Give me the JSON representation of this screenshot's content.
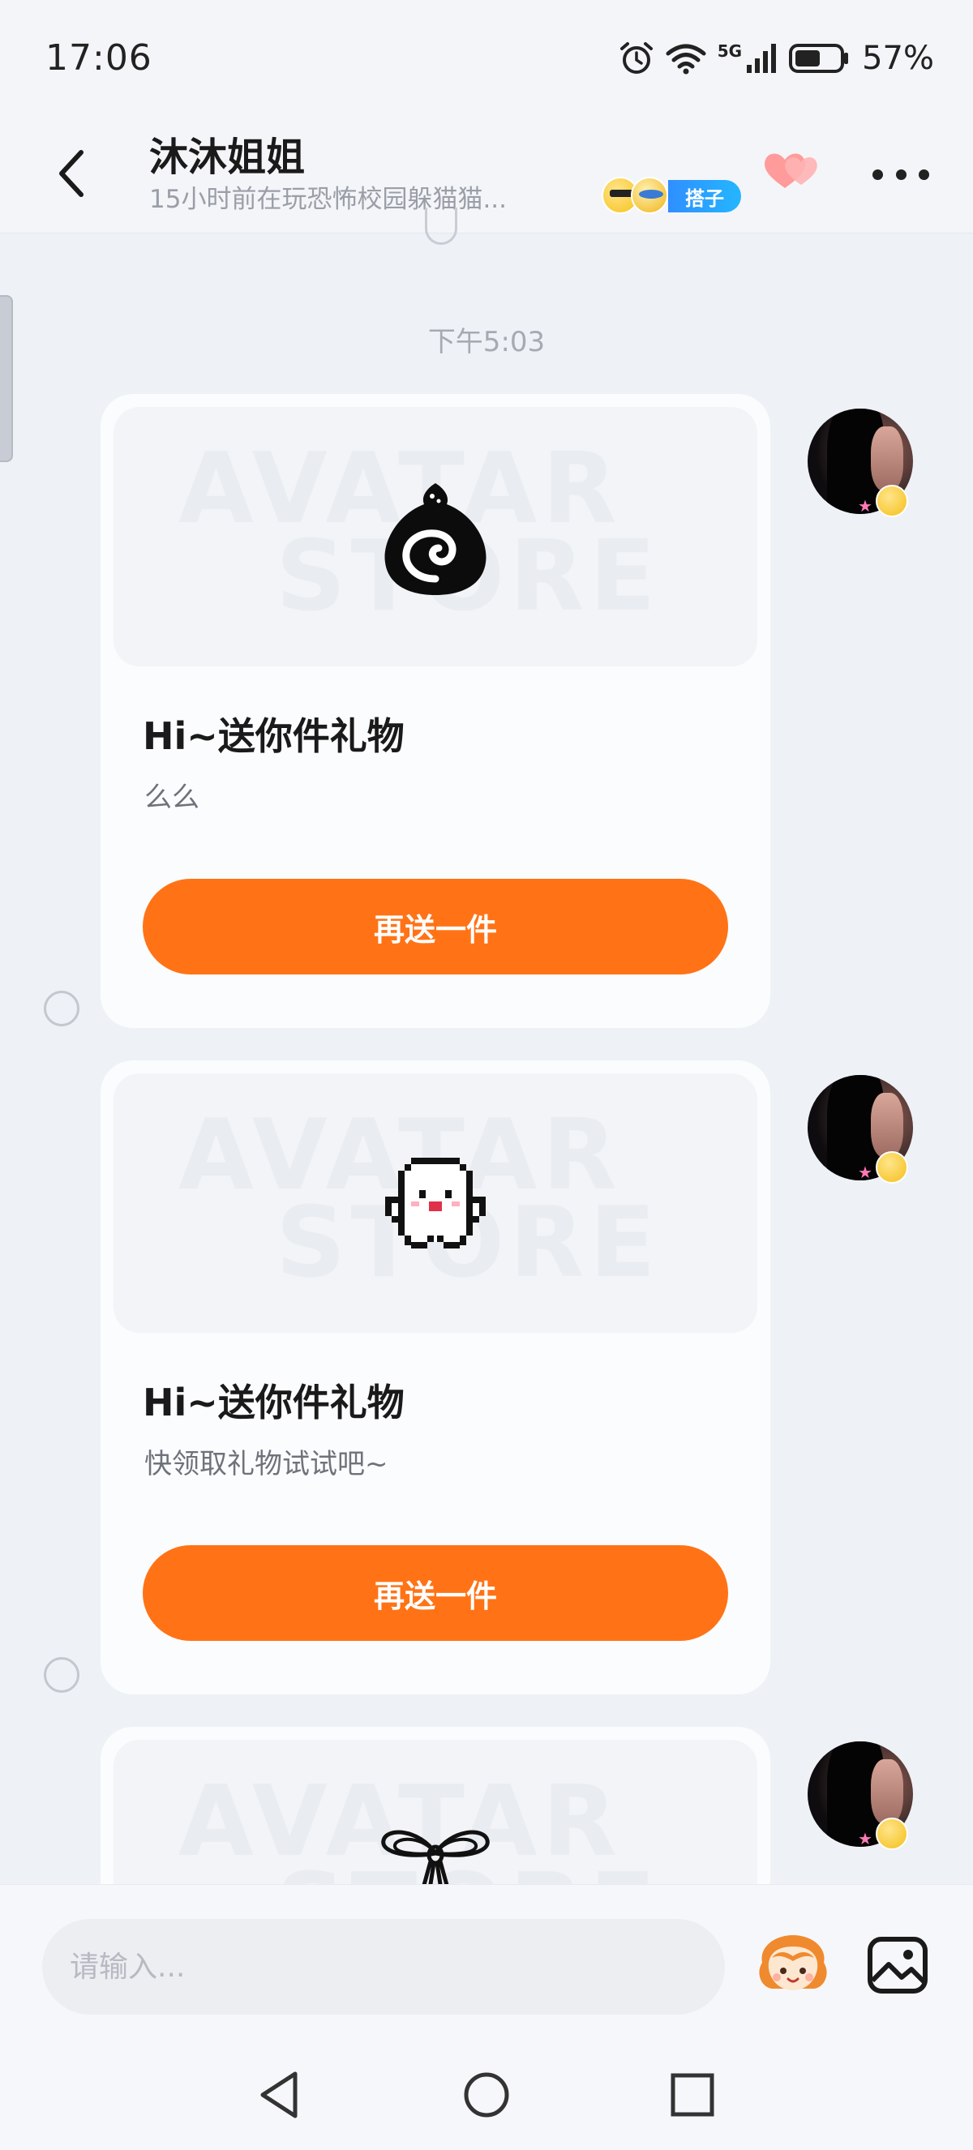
{
  "status_bar": {
    "time": "17:06",
    "network_label": "5G",
    "battery_percent": "57%",
    "battery_level": 0.57,
    "icons": [
      "alarm-icon",
      "wifi-icon",
      "signal-icon",
      "battery-icon"
    ]
  },
  "header": {
    "title": "沐沐姐姐",
    "subtitle": "15小时前在玩恐怖校园躲猫猫...",
    "tag_label": "搭子",
    "icons": [
      "back-icon",
      "hearts-icon",
      "more-icon"
    ]
  },
  "chat": {
    "timestamp": "下午5:03",
    "watermark": [
      "AVATAR",
      "STORE"
    ],
    "messages": [
      {
        "title": "Hi~送你件礼物",
        "text": "么么",
        "button_label": "再送一件",
        "gift_icon": "swirl-bun-icon"
      },
      {
        "title": "Hi~送你件礼物",
        "text": "快领取礼物试试吧~",
        "button_label": "再送一件",
        "gift_icon": "pixel-ghost-icon"
      },
      {
        "title": "",
        "text": "",
        "button_label": "",
        "gift_icon": "bow-ribbon-icon"
      }
    ]
  },
  "input_bar": {
    "placeholder": "请输入...",
    "value": "",
    "icons": [
      "mascot-icon",
      "image-icon"
    ]
  },
  "nav_bar": {
    "icons": [
      "nav-back-icon",
      "nav-home-icon",
      "nav-recents-icon"
    ]
  },
  "colors": {
    "accent": "#ff7316",
    "background": "#eef1f6",
    "card": "#fbfcfd",
    "badge": "#2f8fff"
  }
}
